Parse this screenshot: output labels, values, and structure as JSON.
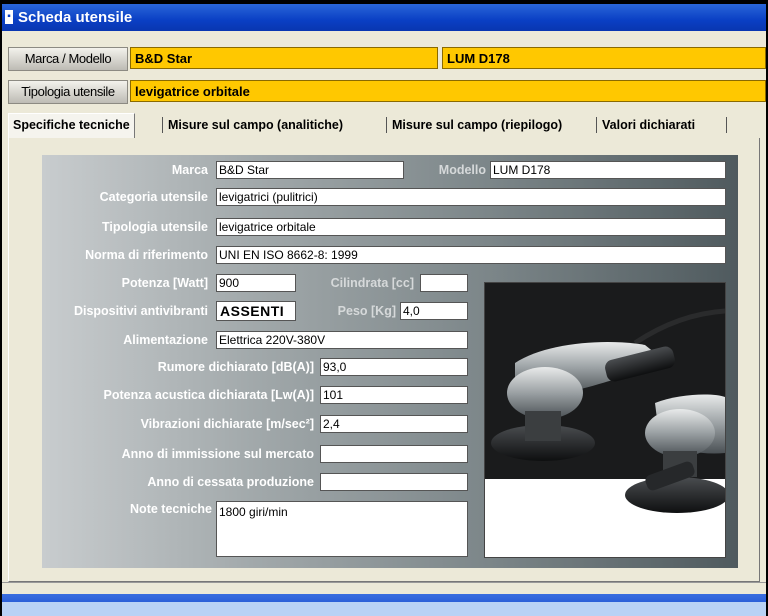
{
  "window": {
    "title": "Scheda utensile",
    "icon": "app-icon"
  },
  "header": {
    "marca_modello_label": "Marca / Modello",
    "marca_value": "B&D Star",
    "modello_value": "LUM D178",
    "tipologia_label": "Tipologia utensile",
    "tipologia_value": "levigatrice orbitale",
    "field_color": "#ffc800"
  },
  "tabs": [
    {
      "label": "Specifiche tecniche",
      "active": true
    },
    {
      "label": "Misure sul campo (analitiche)",
      "active": false
    },
    {
      "label": "Misure sul campo (riepilogo)",
      "active": false
    },
    {
      "label": "Valori dichiarati",
      "active": false
    }
  ],
  "form": {
    "marca": {
      "label": "Marca",
      "value": "B&D Star"
    },
    "modello": {
      "label": "Modello",
      "value": "LUM D178"
    },
    "categoria": {
      "label": "Categoria utensile",
      "value": "levigatrici (pulitrici)"
    },
    "tipologia": {
      "label": "Tipologia utensile",
      "value": "levigatrice orbitale"
    },
    "norma": {
      "label": "Norma di riferimento",
      "value": "UNI EN ISO 8662-8: 1999"
    },
    "potenza": {
      "label": "Potenza [Watt]",
      "value": "900"
    },
    "cilindrata": {
      "label": "Cilindrata [cc]",
      "value": ""
    },
    "dispositivi": {
      "label": "Dispositivi antivibranti",
      "value": "ASSENTI"
    },
    "peso": {
      "label": "Peso  [Kg]",
      "value": "4,0"
    },
    "alimentazione": {
      "label": "Alimentazione",
      "value": "Elettrica 220V-380V"
    },
    "rumore": {
      "label": "Rumore dichiarato  [dB(A)]",
      "value": "93,0"
    },
    "potenza_acustica": {
      "label": "Potenza acustica dichiarata  [Lw(A)]",
      "value": "101"
    },
    "vibrazioni": {
      "label": "Vibrazioni dichiarate  [m/sec²]",
      "value": "2,4"
    },
    "anno_immissione": {
      "label": "Anno di immissione sul mercato",
      "value": ""
    },
    "anno_cessata": {
      "label": "Anno di cessata produzione",
      "value": ""
    },
    "note": {
      "label": "Note tecniche",
      "value": "1800 giri/min"
    }
  },
  "photo": {
    "icon": "orbital-sander-photo"
  }
}
